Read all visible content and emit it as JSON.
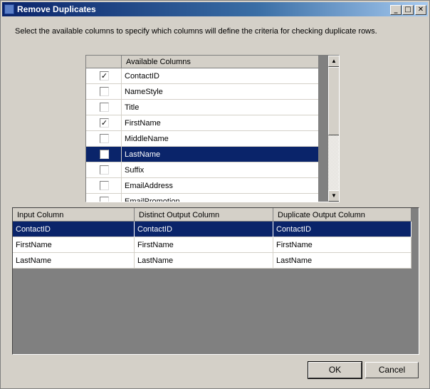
{
  "window": {
    "title": "Remove Duplicates",
    "controls": {
      "minimize": "_",
      "maximize": "□",
      "close": "✕"
    }
  },
  "instructions": "Select the available columns to specify which columns will define the criteria for checking duplicate rows.",
  "available_columns": {
    "header": "Available Columns",
    "rows": [
      {
        "name": "ContactID",
        "checked": true,
        "selected": false
      },
      {
        "name": "NameStyle",
        "checked": false,
        "selected": false
      },
      {
        "name": "Title",
        "checked": false,
        "selected": false
      },
      {
        "name": "FirstName",
        "checked": true,
        "selected": false
      },
      {
        "name": "MiddleName",
        "checked": false,
        "selected": false
      },
      {
        "name": "LastName",
        "checked": true,
        "selected": true
      },
      {
        "name": "Suffix",
        "checked": false,
        "selected": false
      },
      {
        "name": "EmailAddress",
        "checked": false,
        "selected": false
      },
      {
        "name": "EmailPromotion",
        "checked": false,
        "selected": false
      }
    ],
    "scroll_up_icon": "▲",
    "scroll_down_icon": "▼"
  },
  "output_grid": {
    "headers": [
      "Input Column",
      "Distinct Output Column",
      "Duplicate Output Column"
    ],
    "rows": [
      {
        "cells": [
          "ContactID",
          "ContactID",
          "ContactID"
        ],
        "selected": true
      },
      {
        "cells": [
          "FirstName",
          "FirstName",
          "FirstName"
        ],
        "selected": false
      },
      {
        "cells": [
          "LastName",
          "LastName",
          "LastName"
        ],
        "selected": false
      }
    ]
  },
  "buttons": {
    "ok": "OK",
    "cancel": "Cancel"
  },
  "colors": {
    "selection": "#0a246a",
    "dialog": "#d4d0c8",
    "title_start": "#0a246a"
  }
}
